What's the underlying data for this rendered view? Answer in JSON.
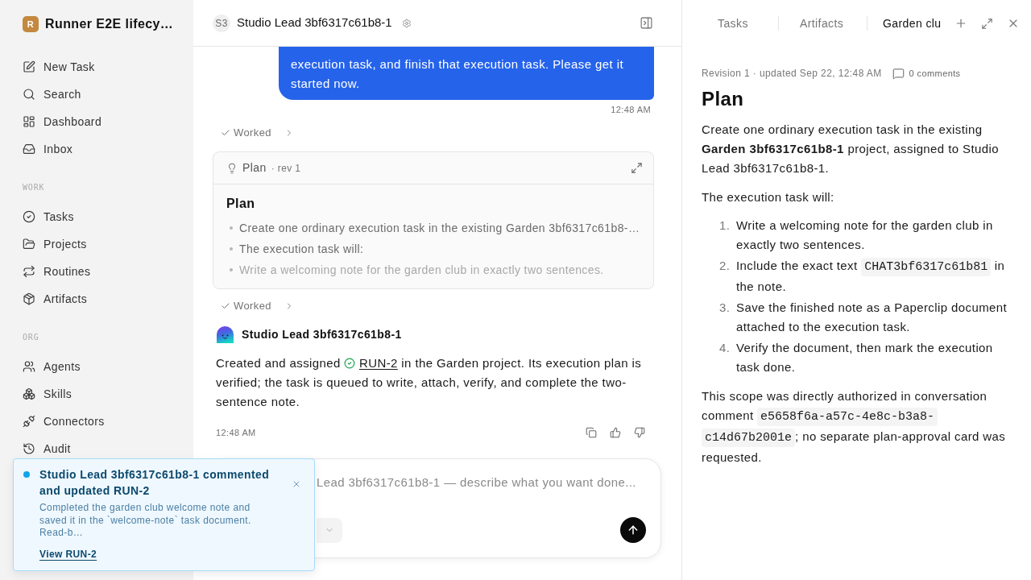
{
  "sidebar": {
    "workspace": {
      "initial": "R",
      "name": "Runner E2E lifecy…"
    },
    "sections": [
      {
        "items": [
          {
            "label": "New Task"
          },
          {
            "label": "Search"
          },
          {
            "label": "Dashboard"
          },
          {
            "label": "Inbox"
          }
        ]
      },
      {
        "heading": "WORK",
        "items": [
          {
            "label": "Tasks"
          },
          {
            "label": "Projects"
          },
          {
            "label": "Routines"
          },
          {
            "label": "Artifacts"
          }
        ]
      },
      {
        "heading": "ORG",
        "items": [
          {
            "label": "Agents"
          },
          {
            "label": "Skills"
          },
          {
            "label": "Connectors"
          },
          {
            "label": "Audit"
          }
        ]
      }
    ]
  },
  "chat": {
    "header": {
      "avatar": "S3",
      "title": "Studio Lead 3bf6317c61b8-1"
    },
    "messages": [
      {
        "kind": "user",
        "text": "execution task, and finish that execution task. Please get it started now.",
        "time": "12:48 AM"
      },
      {
        "kind": "activity",
        "label": "Worked"
      },
      {
        "kind": "plan",
        "label": "Plan",
        "revision": "· rev 1",
        "heading": "Plan",
        "bullets": [
          "Create one ordinary execution task in the existing Garden 3bf6317c61b8-…",
          "The execution task will:",
          "Write a welcoming note for the garden club in exactly two sentences."
        ]
      },
      {
        "kind": "activity",
        "label": "Worked"
      },
      {
        "kind": "agent",
        "author": "Studio Lead 3bf6317c61b8-1",
        "before": "Created and assigned",
        "link": "RUN-2",
        "after": "in the Garden project. Its execution plan is verified; the task is queued to write, attach, verify, and complete the two-sentence note.",
        "time": "12:48 AM"
      }
    ],
    "composer": {
      "placeholder": "Lead 3bf6317c61b8-1 — describe what you want done..."
    }
  },
  "panel": {
    "tabs": [
      {
        "label": "Tasks",
        "selected": false
      },
      {
        "label": "Artifacts",
        "selected": false
      },
      {
        "label": "Garden clu",
        "selected": true
      }
    ],
    "document": {
      "meta": "Revision 1 · updated Sep 22, 12:48 AM",
      "comments": "0 comments",
      "title": "Plan",
      "blocks": [
        {
          "kind": "paragraph",
          "parts": [
            {
              "kind": "text",
              "text": "Create one ordinary execution task in the existing **Garden 3bf6317c61b8-1** project, assigned to Studio Lead 3bf6317c61b8-1."
            }
          ]
        },
        {
          "kind": "paragraph",
          "parts": [
            {
              "kind": "text",
              "text": "The execution task will:"
            }
          ]
        },
        {
          "kind": "ordered_list",
          "items": [
            {
              "number": "1.",
              "parts": [
                {
                  "kind": "text",
                  "text": "Write a welcoming note for the garden club in exactly two sentences."
                }
              ]
            },
            {
              "number": "2.",
              "parts": [
                {
                  "kind": "text",
                  "text": "Include the exact text "
                },
                {
                  "kind": "code",
                  "text": "CHAT3bf6317c61b81"
                },
                {
                  "kind": "text",
                  "text": " in the note."
                }
              ]
            },
            {
              "number": "3.",
              "parts": [
                {
                  "kind": "text",
                  "text": "Save the finished note as a Paperclip document attached to the execution task."
                }
              ]
            },
            {
              "number": "4.",
              "parts": [
                {
                  "kind": "text",
                  "text": "Verify the document, then mark the execution task done."
                }
              ]
            }
          ]
        },
        {
          "kind": "paragraph",
          "parts": [
            {
              "kind": "text",
              "text": "This scope was directly authorized in conversation comment "
            },
            {
              "kind": "code",
              "text": "e5658f6a-a57c-4e8c-b3a8-"
            },
            {
              "kind": "code",
              "text": "c14d67b2001e"
            },
            {
              "kind": "text",
              "text": "; no separate plan-approval card was requested."
            }
          ]
        }
      ]
    }
  },
  "toast": {
    "unread": true,
    "title": "Studio Lead 3bf6317c61b8-1 commented and updated RUN-2",
    "body": "Completed the garden club welcome note and saved it in the `welcome-note` task document. Read-b…",
    "link": "View RUN-2"
  }
}
